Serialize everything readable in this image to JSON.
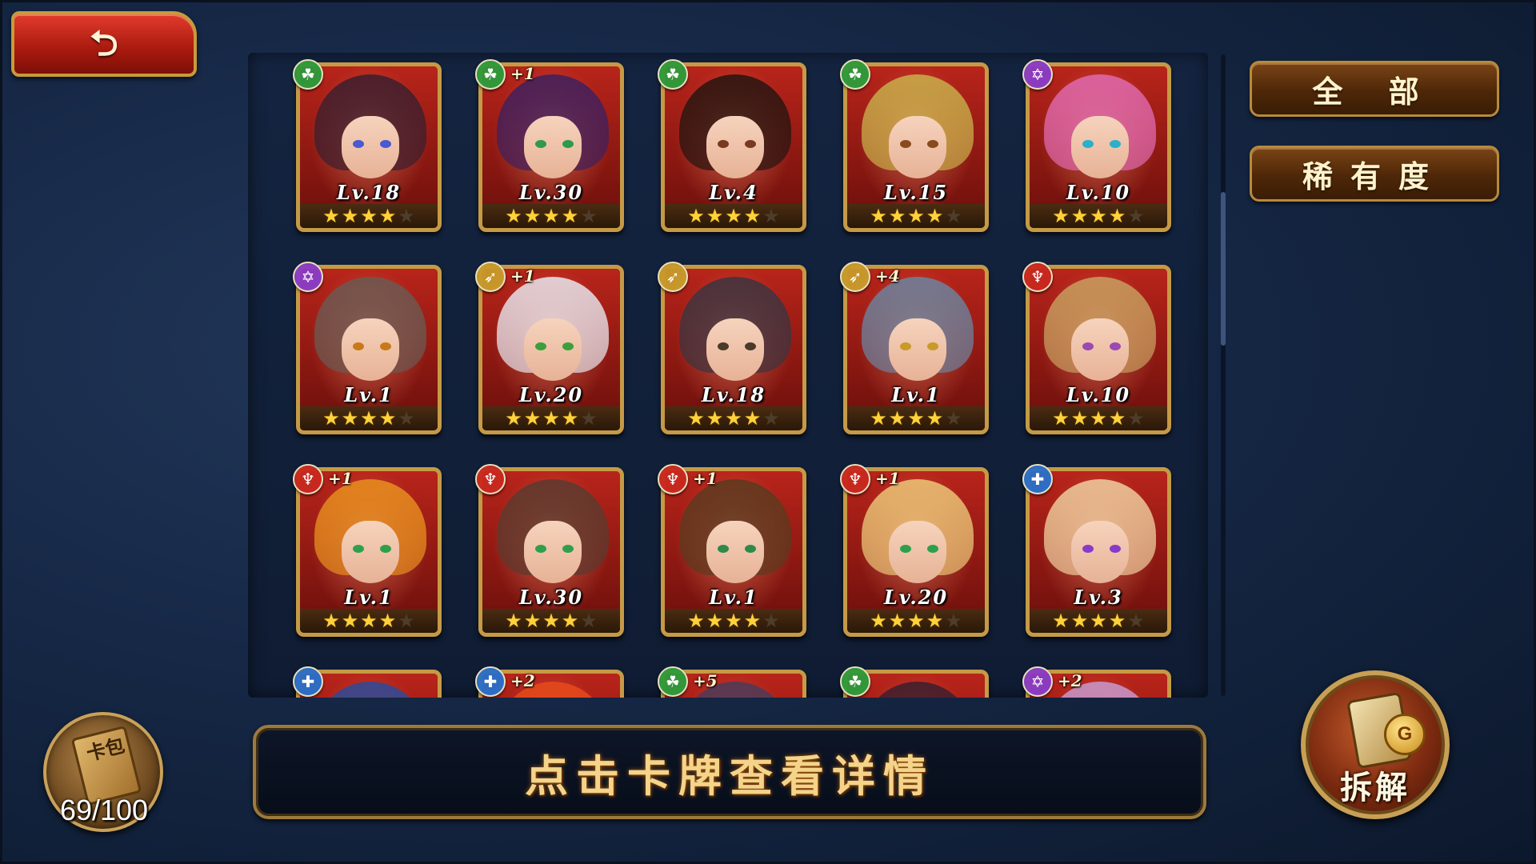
{
  "back_button": {
    "icon": "return-arrow-icon",
    "glyph": "⮌"
  },
  "filters": {
    "all_label": "全 部",
    "rarity_label": "稀有度"
  },
  "info_bar": {
    "text": "点击卡牌查看详情"
  },
  "card_pack": {
    "label": "卡包",
    "count": "69/100"
  },
  "dismantle": {
    "label": "拆解",
    "coin_glyph": "G"
  },
  "star_glyph": "★",
  "max_stars": 5,
  "elements": {
    "nature": {
      "icon": "nature-element-icon",
      "color": "#2e9a3a",
      "glyph": "☘"
    },
    "arcane": {
      "icon": "arcane-hexagram-icon",
      "color": "#8a3cc4",
      "glyph": "✡"
    },
    "ranger": {
      "icon": "bow-arrow-icon",
      "color": "#c89a2a",
      "glyph": "➶"
    },
    "warrior": {
      "icon": "sword-emblem-icon",
      "color": "#c8281e",
      "glyph": "♆"
    },
    "guardian": {
      "icon": "shield-cross-icon",
      "color": "#2a6fc8",
      "glyph": "✚"
    }
  },
  "cards": [
    {
      "level": "Lv.18",
      "element": "nature",
      "plus": "",
      "stars": 4,
      "hair": "#3a1e2e",
      "eyes": "#4a5ad0"
    },
    {
      "level": "Lv.30",
      "element": "nature",
      "plus": "+1",
      "stars": 4,
      "hair": "#3d1f5e",
      "eyes": "#2e9a4a"
    },
    {
      "level": "Lv.4",
      "element": "nature",
      "plus": "",
      "stars": 4,
      "hair": "#241410",
      "eyes": "#7a3a20"
    },
    {
      "level": "Lv.15",
      "element": "nature",
      "plus": "",
      "stars": 4,
      "hair": "#c8b04a",
      "eyes": "#8a4a20"
    },
    {
      "level": "Lv.10",
      "element": "arcane",
      "plus": "",
      "stars": 4,
      "hair": "#e06ab0",
      "eyes": "#2ab0c8"
    },
    {
      "level": "Lv.1",
      "element": "arcane",
      "plus": "",
      "stars": 4,
      "hair": "#6a5a52",
      "eyes": "#c87a1a"
    },
    {
      "level": "Lv.20",
      "element": "ranger",
      "plus": "+1",
      "stars": 4,
      "hair": "#e8e8f0",
      "eyes": "#3aa03a"
    },
    {
      "level": "Lv.18",
      "element": "ranger",
      "plus": "",
      "stars": 4,
      "hair": "#3a3440",
      "eyes": "#4a3a2a"
    },
    {
      "level": "Lv.1",
      "element": "ranger",
      "plus": "+4",
      "stars": 4,
      "hair": "#6a84a0",
      "eyes": "#c89a2a"
    },
    {
      "level": "Lv.10",
      "element": "warrior",
      "plus": "",
      "stars": 4,
      "hair": "#c8a060",
      "eyes": "#9a4ab0"
    },
    {
      "level": "Lv.1",
      "element": "warrior",
      "plus": "+1",
      "stars": 4,
      "hair": "#e8901e",
      "eyes": "#2ea04a"
    },
    {
      "level": "Lv.30",
      "element": "warrior",
      "plus": "",
      "stars": 4,
      "hair": "#5a3a2e",
      "eyes": "#2ea04a"
    },
    {
      "level": "Lv.1",
      "element": "warrior",
      "plus": "+1",
      "stars": 4,
      "hair": "#5a3a1e",
      "eyes": "#2e8a4a"
    },
    {
      "level": "Lv.20",
      "element": "warrior",
      "plus": "+1",
      "stars": 4,
      "hair": "#ecc878",
      "eyes": "#2ea04a"
    },
    {
      "level": "Lv.3",
      "element": "guardian",
      "plus": "",
      "stars": 4,
      "hair": "#f0d0a0",
      "eyes": "#8a3ac8"
    },
    {
      "level": "",
      "element": "guardian",
      "plus": "",
      "stars": 0,
      "hair": "#2a4a9a",
      "eyes": "#2a4a9a"
    },
    {
      "level": "",
      "element": "guardian",
      "plus": "+2",
      "stars": 0,
      "hair": "#e84a1a",
      "eyes": "#e84a1a"
    },
    {
      "level": "",
      "element": "nature",
      "plus": "+5",
      "stars": 0,
      "hair": "#4a3a5a",
      "eyes": "#4a3a5a"
    },
    {
      "level": "",
      "element": "nature",
      "plus": "",
      "stars": 0,
      "hair": "#3a1e2e",
      "eyes": "#3a1e2e"
    },
    {
      "level": "",
      "element": "arcane",
      "plus": "+2",
      "stars": 0,
      "hair": "#c89ad0",
      "eyes": "#c89ad0"
    }
  ]
}
